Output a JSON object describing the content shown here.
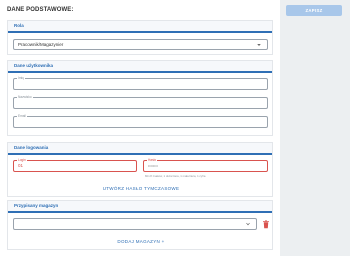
{
  "header": {
    "title": "DANE PODSTAWOWE:",
    "save_label": "ZAPISZ"
  },
  "role_section": {
    "title": "Rola",
    "role_value": "Pracownik/Magazynier"
  },
  "user_section": {
    "title": "Dane użytkownika",
    "first_name_label": "Imię",
    "last_name_label": "Nazwisko",
    "email_label": "Email"
  },
  "login_section": {
    "title": "Dane logowania",
    "login_label": "Login",
    "login_value": "01",
    "password_label": "Hasło",
    "password_value": "••••••••",
    "password_hint": "Min 8 znaków, 1 duża litera, 1 mała litera, 1 cyfra",
    "temp_password_link": "UTWÓRZ HASŁO TYMCZASOWE"
  },
  "warehouse_section": {
    "title": "Przypisany magazyn",
    "warehouse_value": "",
    "add_warehouse_link": "DODAJ MAGAZYN +"
  },
  "colors": {
    "accent": "#2f6fb5",
    "error": "#d9534f",
    "save_button": "#a8c7ea"
  },
  "icons": [
    "chevron-down-icon",
    "trash-icon"
  ]
}
